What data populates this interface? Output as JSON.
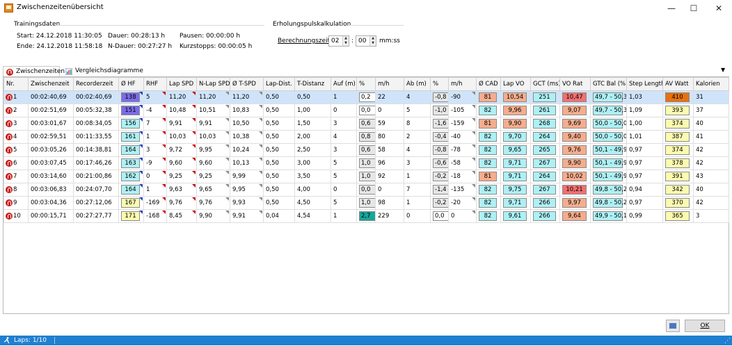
{
  "window": {
    "title": "Zwischenzeitenübersicht",
    "minimize": "—",
    "maximize": "☐",
    "close": "✕"
  },
  "training": {
    "section": "Trainingsdaten",
    "start": "Start: 24.12.2018 11:30:05",
    "ende": "Ende: 24.12.2018 11:58:18",
    "dauer": "Dauer: 00:28:13 h",
    "ndauer": "N-Dauer: 00:27:27 h",
    "pausen": "Pausen: 00:00:00 h",
    "kurzstopps": "Kurzstopps: 00:00:05 h"
  },
  "erholung": {
    "section": "Erholungspulskalkulation",
    "label": "Berechnungszeit",
    "minutes": "02",
    "seconds": "00",
    "sep": ":",
    "unit": "mm:ss"
  },
  "tabs": [
    {
      "label": "Zwischenzeiten",
      "icon": "lap-icon"
    },
    {
      "label": "Vergleichsdiagramme",
      "icon": "chart-icon"
    }
  ],
  "columns": [
    "Nr.",
    "Zwischenzeit",
    "Recorderzeit",
    "Ø HF",
    "RHF",
    "Lap SPD",
    "N-Lap SPD",
    "Ø T-SPD",
    "Lap-Dist.",
    "T-Distanz",
    "Auf (m)",
    "%",
    "m/h",
    "Ab (m)",
    "%",
    "m/h",
    "Ø CAD",
    "Lap VO",
    "GCT (ms)",
    "VO Rat",
    "GTC Bal (%)",
    "Step Length",
    "AV Watt",
    "Kalorien"
  ],
  "colors": {
    "hf_purple": "#7b6be8",
    "hf_cyan": "#aef0f4",
    "hf_yellow": "#fafab0",
    "salmon": "#f4ad8e",
    "red": "#f07070",
    "teal": "#19a59a",
    "orange": "#e6720f",
    "cyan": "#aef0f4",
    "grey": "#e6e6e6"
  },
  "rows": [
    {
      "nr": "1",
      "zz": "00:02:40,69",
      "rz": "00:02:40,69",
      "hf": "138",
      "hfc": "hf_purple",
      "rhf": "5",
      "lap": "11,20",
      "nlap": "11,20",
      "tspd": "11,20",
      "ldist": "0,50",
      "tdist": "0,50",
      "auf": "1",
      "ap": "0,2",
      "apc": "white",
      "amh": "22",
      "ab": "4",
      "bp": "-0,8",
      "bmh": "-90",
      "cad": "81",
      "cadc": "salmon",
      "vo": "10,54",
      "voc": "salmon",
      "gct": "251",
      "vor": "10,47",
      "vorc": "red",
      "bal": "49,7 - 50,3",
      "step": "1,03",
      "watt": "410",
      "wattc": "orange",
      "kal": "31"
    },
    {
      "nr": "2",
      "zz": "00:02:51,69",
      "rz": "00:05:32,38",
      "hf": "151",
      "hfc": "hf_purple",
      "rhf": "-4",
      "lap": "10,48",
      "nlap": "10,51",
      "tspd": "10,83",
      "ldist": "0,50",
      "tdist": "1,00",
      "auf": "0",
      "ap": "0,0",
      "apc": "white",
      "amh": "0",
      "ab": "5",
      "bp": "-1,0",
      "bmh": "-105",
      "cad": "82",
      "cadc": "cyan",
      "vo": "9,96",
      "voc": "salmon",
      "gct": "261",
      "vor": "9,07",
      "vorc": "salmon",
      "bal": "49,7 - 50,3",
      "step": "1,09",
      "watt": "393",
      "wattc": "hf_yellow",
      "kal": "37"
    },
    {
      "nr": "3",
      "zz": "00:03:01,67",
      "rz": "00:08:34,05",
      "hf": "156",
      "hfc": "hf_cyan",
      "rhf": "7",
      "lap": "9,91",
      "nlap": "9,91",
      "tspd": "10,50",
      "ldist": "0,50",
      "tdist": "1,50",
      "auf": "3",
      "ap": "0,6",
      "apc": "grey",
      "amh": "59",
      "ab": "8",
      "bp": "-1,6",
      "bmh": "-159",
      "cad": "81",
      "cadc": "salmon",
      "vo": "9,90",
      "voc": "salmon",
      "gct": "268",
      "vor": "9,69",
      "vorc": "salmon",
      "bal": "50,0 - 50,0",
      "step": "1,00",
      "watt": "374",
      "wattc": "hf_yellow",
      "kal": "40"
    },
    {
      "nr": "4",
      "zz": "00:02:59,51",
      "rz": "00:11:33,55",
      "hf": "161",
      "hfc": "hf_cyan",
      "rhf": "1",
      "lap": "10,03",
      "nlap": "10,03",
      "tspd": "10,38",
      "ldist": "0,50",
      "tdist": "2,00",
      "auf": "4",
      "ap": "0,8",
      "apc": "grey",
      "amh": "80",
      "ab": "2",
      "bp": "-0,4",
      "bmh": "-40",
      "cad": "82",
      "cadc": "cyan",
      "vo": "9,70",
      "voc": "cyan",
      "gct": "264",
      "vor": "9,40",
      "vorc": "salmon",
      "bal": "50,0 - 50,0",
      "step": "1,01",
      "watt": "387",
      "wattc": "hf_yellow",
      "kal": "41"
    },
    {
      "nr": "5",
      "zz": "00:03:05,26",
      "rz": "00:14:38,81",
      "hf": "164",
      "hfc": "hf_cyan",
      "rhf": "3",
      "lap": "9,72",
      "nlap": "9,95",
      "tspd": "10,24",
      "ldist": "0,50",
      "tdist": "2,50",
      "auf": "3",
      "ap": "0,6",
      "apc": "grey",
      "amh": "58",
      "ab": "4",
      "bp": "-0,8",
      "bmh": "-78",
      "cad": "82",
      "cadc": "cyan",
      "vo": "9,65",
      "voc": "cyan",
      "gct": "265",
      "vor": "9,76",
      "vorc": "salmon",
      "bal": "50,1 - 49,9",
      "step": "0,97",
      "watt": "374",
      "wattc": "hf_yellow",
      "kal": "42"
    },
    {
      "nr": "6",
      "zz": "00:03:07,45",
      "rz": "00:17:46,26",
      "hf": "163",
      "hfc": "hf_cyan",
      "rhf": "-9",
      "lap": "9,60",
      "nlap": "9,60",
      "tspd": "10,13",
      "ldist": "0,50",
      "tdist": "3,00",
      "auf": "5",
      "ap": "1,0",
      "apc": "grey",
      "amh": "96",
      "ab": "3",
      "bp": "-0,6",
      "bmh": "-58",
      "cad": "82",
      "cadc": "cyan",
      "vo": "9,71",
      "voc": "cyan",
      "gct": "267",
      "vor": "9,90",
      "vorc": "salmon",
      "bal": "50,1 - 49,9",
      "step": "0,97",
      "watt": "378",
      "wattc": "hf_yellow",
      "kal": "42"
    },
    {
      "nr": "7",
      "zz": "00:03:14,60",
      "rz": "00:21:00,86",
      "hf": "162",
      "hfc": "hf_cyan",
      "rhf": "0",
      "lap": "9,25",
      "nlap": "9,25",
      "tspd": "9,99",
      "ldist": "0,50",
      "tdist": "3,50",
      "auf": "5",
      "ap": "1,0",
      "apc": "grey",
      "amh": "92",
      "ab": "1",
      "bp": "-0,2",
      "bmh": "-18",
      "cad": "81",
      "cadc": "salmon",
      "vo": "9,71",
      "voc": "cyan",
      "gct": "264",
      "vor": "10,02",
      "vorc": "salmon",
      "bal": "50,1 - 49,9",
      "step": "0,97",
      "watt": "391",
      "wattc": "hf_yellow",
      "kal": "43"
    },
    {
      "nr": "8",
      "zz": "00:03:06,83",
      "rz": "00:24:07,70",
      "hf": "164",
      "hfc": "hf_cyan",
      "rhf": "1",
      "lap": "9,63",
      "nlap": "9,65",
      "tspd": "9,95",
      "ldist": "0,50",
      "tdist": "4,00",
      "auf": "0",
      "ap": "0,0",
      "apc": "grey",
      "amh": "0",
      "ab": "7",
      "bp": "-1,4",
      "bmh": "-135",
      "cad": "82",
      "cadc": "cyan",
      "vo": "9,75",
      "voc": "cyan",
      "gct": "267",
      "vor": "10,21",
      "vorc": "red",
      "bal": "49,8 - 50,2",
      "step": "0,94",
      "watt": "342",
      "wattc": "hf_yellow",
      "kal": "40"
    },
    {
      "nr": "9",
      "zz": "00:03:04,36",
      "rz": "00:27:12,06",
      "hf": "167",
      "hfc": "hf_yellow",
      "rhf": "-169",
      "lap": "9,76",
      "nlap": "9,76",
      "tspd": "9,93",
      "ldist": "0,50",
      "tdist": "4,50",
      "auf": "5",
      "ap": "1,0",
      "apc": "grey",
      "amh": "98",
      "ab": "1",
      "bp": "-0,2",
      "bmh": "-20",
      "cad": "82",
      "cadc": "cyan",
      "vo": "9,71",
      "voc": "cyan",
      "gct": "266",
      "vor": "9,97",
      "vorc": "salmon",
      "bal": "49,8 - 50,2",
      "step": "0,97",
      "watt": "370",
      "wattc": "hf_yellow",
      "kal": "42"
    },
    {
      "nr": "10",
      "zz": "00:00:15,71",
      "rz": "00:27:27,77",
      "hf": "171",
      "hfc": "hf_yellow",
      "rhf": "-168",
      "lap": "8,45",
      "nlap": "9,90",
      "tspd": "9,91",
      "ldist": "0,04",
      "tdist": "4,54",
      "auf": "1",
      "ap": "2,7",
      "apc": "teal",
      "amh": "229",
      "ab": "0",
      "bp": "0,0",
      "bmh": "0",
      "cad": "82",
      "cadc": "cyan",
      "vo": "9,61",
      "voc": "cyan",
      "gct": "266",
      "vor": "9,64",
      "vorc": "salmon",
      "bal": "49,9 - 50,1",
      "step": "0,99",
      "watt": "365",
      "wattc": "hf_yellow",
      "kal": "3"
    }
  ],
  "buttons": {
    "ok": "OK",
    "export_icon": "export-icon"
  },
  "status": {
    "laps": "Laps: 1/10"
  }
}
